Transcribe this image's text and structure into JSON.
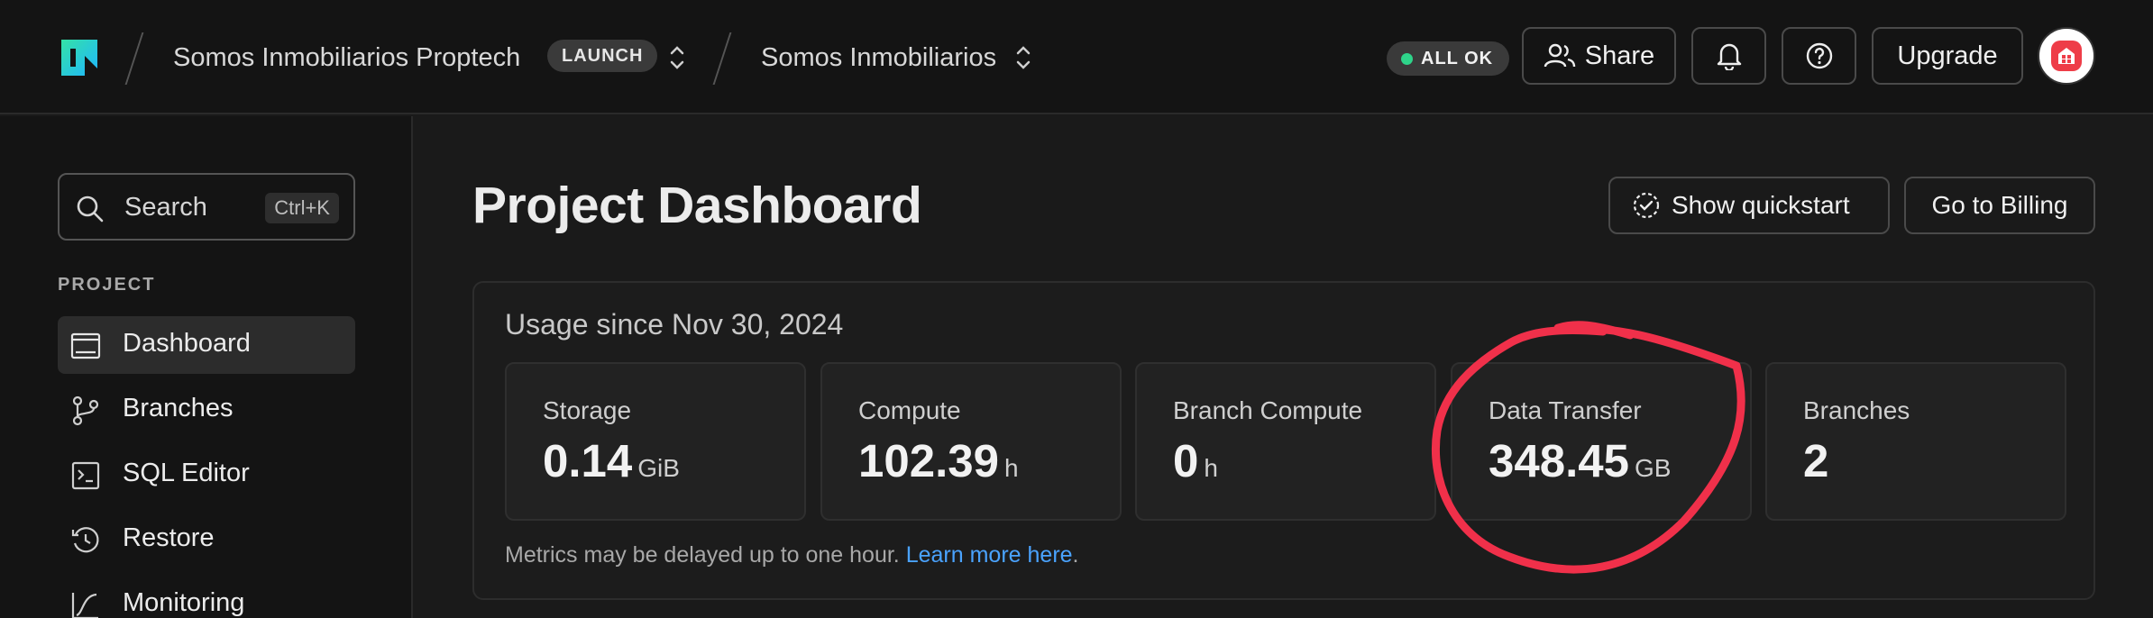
{
  "topbar": {
    "org_name": "Somos Inmobiliarios Proptech",
    "org_plan_badge": "LAUNCH",
    "project_name": "Somos Inmobiliarios",
    "status_text": "ALL OK",
    "share_label": "Share",
    "upgrade_label": "Upgrade"
  },
  "sidebar": {
    "search_label": "Search",
    "search_shortcut": "Ctrl+K",
    "section_label": "PROJECT",
    "items": [
      {
        "label": "Dashboard",
        "icon": "dashboard-icon",
        "active": true
      },
      {
        "label": "Branches",
        "icon": "branches-icon"
      },
      {
        "label": "SQL Editor",
        "icon": "sql-editor-icon"
      },
      {
        "label": "Restore",
        "icon": "restore-icon"
      },
      {
        "label": "Monitoring",
        "icon": "monitoring-icon"
      }
    ]
  },
  "main": {
    "title": "Project Dashboard",
    "show_quickstart_label": "Show quickstart",
    "billing_label": "Go to Billing",
    "usage": {
      "title": "Usage since Nov 30, 2024",
      "cards": [
        {
          "label": "Storage",
          "value": "0.14",
          "unit": "GiB"
        },
        {
          "label": "Compute",
          "value": "102.39",
          "unit": "h"
        },
        {
          "label": "Branch Compute",
          "value": "0",
          "unit": "h"
        },
        {
          "label": "Data Transfer",
          "value": "348.45",
          "unit": "GB"
        },
        {
          "label": "Branches",
          "value": "2",
          "unit": ""
        }
      ],
      "note": "Metrics may be delayed up to one hour.",
      "note_link": "Learn more here",
      "note_end": "."
    }
  },
  "colors": {
    "accent_green": "#2ed48a",
    "link_blue": "#4aa3ff",
    "annotation_red": "#f0304a",
    "avatar_red": "#ee3d48"
  }
}
